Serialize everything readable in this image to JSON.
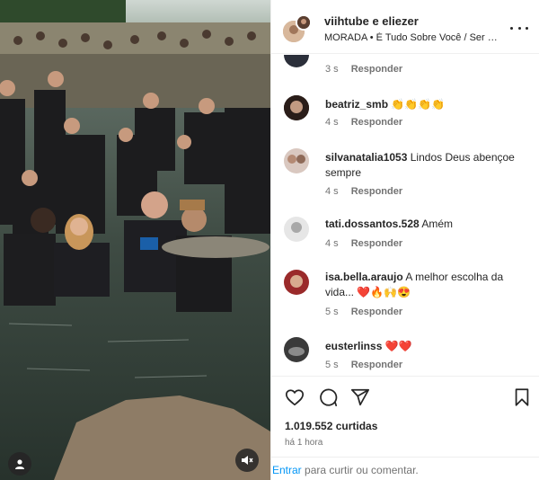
{
  "post": {
    "author": "viihtube e eliezer",
    "music": "MORADA • É Tudo Sobre Você / Ser M..."
  },
  "comments": [
    {
      "username": "",
      "text": "",
      "time": "3 s",
      "reply_label": "Responder"
    },
    {
      "username": "beatriz_smb",
      "text": "👏👏👏👏",
      "time": "4 s",
      "reply_label": "Responder"
    },
    {
      "username": "silvanatalia1053",
      "text": "Lindos Deus abençoe sempre",
      "time": "4 s",
      "reply_label": "Responder"
    },
    {
      "username": "tati.dossantos.528",
      "text": "Amém",
      "time": "4 s",
      "reply_label": "Responder"
    },
    {
      "username": "isa.bella.araujo",
      "text": "A melhor escolha da vida... ❤️🔥🙌😍",
      "time": "5 s",
      "reply_label": "Responder"
    },
    {
      "username": "eusterlinss",
      "text": "❤️❤️",
      "time": "5 s",
      "reply_label": "Responder"
    }
  ],
  "actions": {
    "likes": "1.019.552 curtidas",
    "posted_time": "há 1 hora"
  },
  "login_prompt": {
    "link": "Entrar",
    "text": " para curtir ou comentar."
  },
  "icons": {
    "more": "more-options-icon",
    "like": "heart-icon",
    "comment": "comment-icon",
    "share": "share-icon",
    "save": "bookmark-icon",
    "mute": "mute-icon",
    "tagged": "user-icon"
  },
  "colors": {
    "link": "#0095f6",
    "text": "#262626",
    "secondary": "#737373",
    "divider": "#efefef"
  }
}
